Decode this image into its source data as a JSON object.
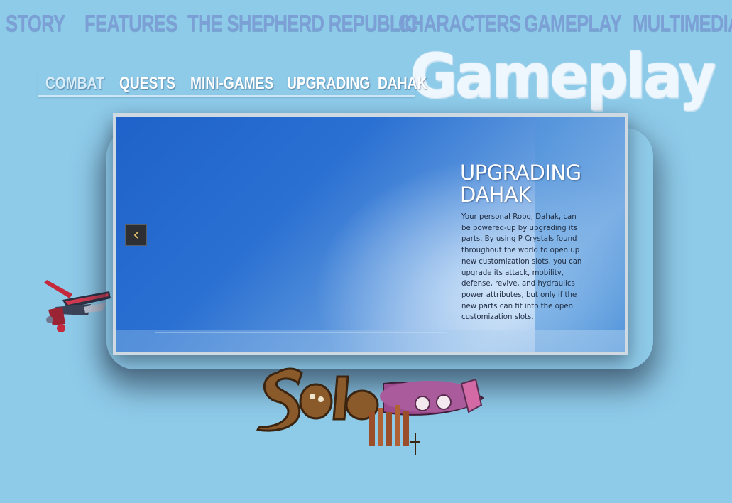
{
  "nav": {
    "items": [
      {
        "label": "STORY"
      },
      {
        "label": "FEATURES"
      },
      {
        "label": "THE SHEPHERD REPUBLIC"
      },
      {
        "label": "CHARACTERS"
      },
      {
        "label": "GAMEPLAY"
      },
      {
        "label": "MULTIMEDIA"
      }
    ]
  },
  "page": {
    "title": "Gameplay"
  },
  "subnav": {
    "items": [
      {
        "label": "COMBAT",
        "active": true
      },
      {
        "label": "QUESTS"
      },
      {
        "label": "MINI-GAMES"
      },
      {
        "label": "UPGRADING  DAHAK"
      }
    ]
  },
  "slider": {
    "heading_line1": "UPGRADING",
    "heading_line2": "DAHAK",
    "body": "Your personal Robo, Dahak, can be powered-up by upgrading its parts. By using P Crystals found throughout the world to open up new customization slots, you can upgrade its attack, mobility, defense, revive, and hydraulics power attributes, but only if the new parts can fit into the open customization slots.",
    "prev_icon": "chevron-left-icon"
  },
  "colors": {
    "background": "#8ecbe9",
    "nav_text": "#7c9fd6",
    "subnav_text": "#ffffff",
    "slide_blue": "#1f62c9"
  }
}
